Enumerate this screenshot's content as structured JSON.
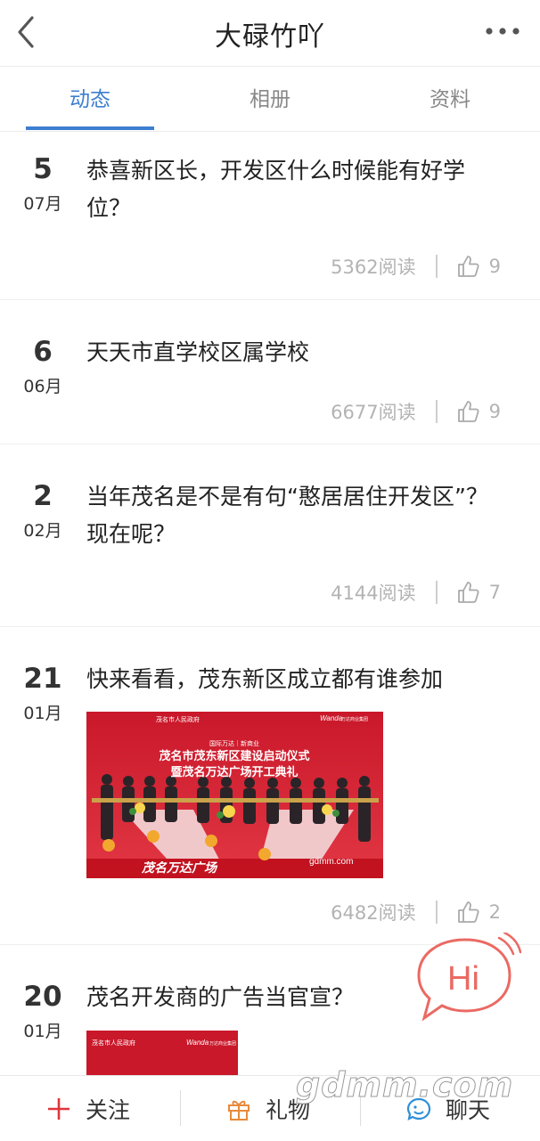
{
  "header": {
    "title": "大碌竹吖",
    "back_icon": "chevron-left-icon",
    "more_icon": "more-dots-icon"
  },
  "tabs": [
    {
      "label": "动态",
      "active": true
    },
    {
      "label": "相册",
      "active": false
    },
    {
      "label": "资料",
      "active": false
    }
  ],
  "posts": [
    {
      "day": "5",
      "month": "07月",
      "title": "恭喜新区长，开发区什么时候能有好学位？",
      "reads": "5362阅读",
      "likes": "9"
    },
    {
      "day": "6",
      "month": "06月",
      "title": "天天市直学校区属学校",
      "reads": "6677阅读",
      "likes": "9"
    },
    {
      "day": "2",
      "month": "02月",
      "title": "当年茂名是不是有句“憨居居住开发区”？现在呢？",
      "reads": "4144阅读",
      "likes": "7"
    },
    {
      "day": "21",
      "month": "01月",
      "title": "快来看看，茂东新区成立都有谁参加",
      "reads": "6482阅读",
      "likes": "2",
      "image": {
        "org": "茂名市人民政府",
        "brand": "Wanda",
        "brand_sub": "万达商业集团",
        "tags": "国际万达｜新商业",
        "line1": "茂名市茂东新区建设启动仪式",
        "line2": "暨茂名万达广场开工典礼",
        "site": "gdmm.com",
        "footer": "茂名万达广场"
      }
    },
    {
      "day": "20",
      "month": "01月",
      "title": "茂名开发商的广告当官宣？",
      "image": {
        "org": "茂名市人民政府",
        "brand": "Wanda",
        "brand_sub": "万达商业集团"
      }
    }
  ],
  "hi_bubble": {
    "text": "Hi"
  },
  "bottom_bar": {
    "follow": "关注",
    "gift": "礼物",
    "chat": "聊天",
    "follow_icon": "plus-icon",
    "gift_icon": "gift-icon",
    "chat_icon": "chat-face-icon"
  },
  "watermark": "gdmm.com",
  "colors": {
    "accent": "#3d7fd1",
    "follow_red": "#e0353b",
    "gift_orange": "#e88a3c",
    "chat_blue": "#2e8fd8",
    "bubble_red": "#ea6a63"
  }
}
